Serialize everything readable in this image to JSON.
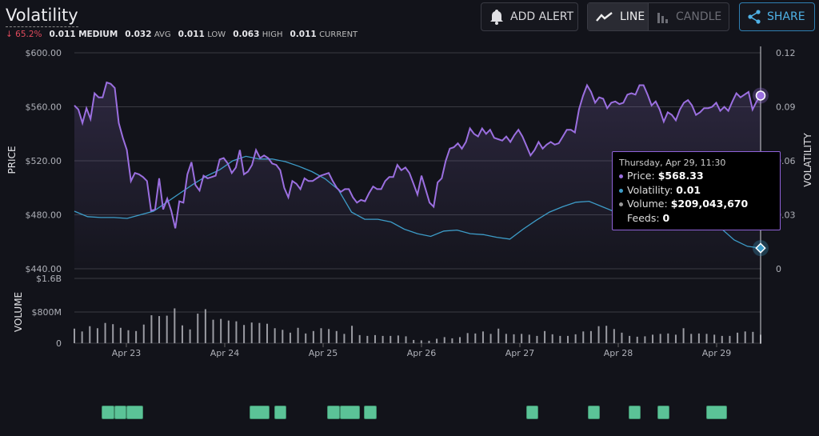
{
  "header": {
    "title": "Volatility",
    "change": "65.2%",
    "change_icon": "arrow-down-icon",
    "stats": [
      {
        "value": "0.011",
        "label": "MEDIUM"
      },
      {
        "value": "0.032",
        "label": "AVG"
      },
      {
        "value": "0.011",
        "label": "LOW"
      },
      {
        "value": "0.063",
        "label": "HIGH"
      },
      {
        "value": "0.011",
        "label": "CURRENT"
      }
    ]
  },
  "toolbar": {
    "add_alert": "ADD ALERT",
    "line": "LINE",
    "candle": "CANDLE",
    "share": "SHARE",
    "active_view": "line"
  },
  "tooltip": {
    "date": "Thursday, Apr 29, 11:30",
    "price_label": "Price:",
    "price": "$568.33",
    "volatility_label": "Volatility:",
    "volatility": "0.01",
    "volume_label": "Volume:",
    "volume": "$209,043,670",
    "feeds_label": "Feeds:",
    "feeds": "0"
  },
  "colors": {
    "price": "#9b6fe0",
    "volatility": "#3d9cc8",
    "volume": "#9a9ba2",
    "feeds": "#5bc397",
    "down": "#e04a5c",
    "share": "#4fb2e6"
  },
  "chart_data": {
    "type": "line",
    "x_ticks": [
      "Apr 23",
      "Apr 24",
      "Apr 25",
      "Apr 26",
      "Apr 27",
      "Apr 28",
      "Apr 29"
    ],
    "last_point": "Apr 29, 11:30",
    "price_axis": {
      "label": "PRICE",
      "ticks": [
        "$600.00",
        "$560.00",
        "$520.00",
        "$480.00",
        "$440.00"
      ],
      "ylim": [
        440,
        600
      ]
    },
    "volatility_axis": {
      "label": "VOLATILITY",
      "ticks": [
        "0.12",
        "0.09",
        "0.06",
        "0.03",
        "0"
      ],
      "ylim": [
        0,
        0.12
      ]
    },
    "volume_axis": {
      "label": "VOLUME",
      "ticks": [
        "$1.6B",
        "$800M",
        "0"
      ],
      "ylim_millions": [
        0,
        1600
      ]
    },
    "series": [
      {
        "name": "Price",
        "values": [
          561,
          558,
          548,
          559,
          551,
          570,
          567,
          567,
          578,
          577,
          574,
          548,
          537,
          528,
          505,
          511,
          510,
          508,
          505,
          483,
          484,
          507,
          484,
          492,
          483,
          470,
          490,
          489,
          510,
          519,
          502,
          498,
          509,
          507,
          508,
          509,
          521,
          522,
          518,
          511,
          515,
          528,
          510,
          512,
          517,
          528,
          522,
          524,
          522,
          518,
          517,
          513,
          500,
          493,
          505,
          503,
          499,
          507,
          505,
          505,
          507,
          509,
          510,
          511,
          505,
          500,
          497,
          499,
          499,
          493,
          489,
          491,
          490,
          496,
          501,
          499,
          499,
          505,
          508,
          508,
          517,
          513,
          515,
          511,
          503,
          495,
          509,
          499,
          489,
          486,
          504,
          507,
          520,
          529,
          530,
          533,
          529,
          534,
          544,
          540,
          538,
          544,
          540,
          543,
          537,
          536,
          535,
          538,
          534,
          539,
          543,
          538,
          531,
          524,
          528,
          534,
          529,
          532,
          534,
          532,
          533,
          538,
          543,
          543,
          541,
          558,
          568,
          576,
          571,
          563,
          567,
          566,
          559,
          563,
          564,
          562,
          563,
          569,
          570,
          569,
          576,
          576,
          569,
          561,
          564,
          558,
          549,
          556,
          554,
          550,
          558,
          563,
          565,
          561,
          554,
          556,
          559,
          559,
          560,
          563,
          557,
          560,
          557,
          564,
          570,
          567,
          569,
          571,
          558,
          564,
          568.33
        ]
      },
      {
        "name": "Volatility",
        "values": [
          0.032,
          0.029,
          0.0285,
          0.0285,
          0.028,
          0.03,
          0.032,
          0.037,
          0.042,
          0.047,
          0.0515,
          0.055,
          0.06,
          0.0625,
          0.061,
          0.061,
          0.0595,
          0.057,
          0.054,
          0.05,
          0.044,
          0.0315,
          0.0275,
          0.0275,
          0.026,
          0.022,
          0.0195,
          0.018,
          0.021,
          0.0215,
          0.0195,
          0.019,
          0.0175,
          0.0165,
          0.022,
          0.027,
          0.0315,
          0.0345,
          0.037,
          0.0375,
          0.0345,
          0.0315,
          0.029,
          0.029,
          0.032,
          0.0275,
          0.026,
          0.026,
          0.025,
          0.0225,
          0.016,
          0.0125,
          0.0115
        ]
      },
      {
        "name": "Volume",
        "unit": "millions",
        "values": [
          360,
          290,
          420,
          370,
          500,
          470,
          380,
          320,
          300,
          460,
          690,
          670,
          680,
          860,
          440,
          340,
          730,
          840,
          580,
          600,
          560,
          540,
          450,
          510,
          500,
          480,
          370,
          330,
          260,
          380,
          240,
          300,
          370,
          350,
          300,
          230,
          430,
          200,
          180,
          200,
          180,
          180,
          190,
          170,
          80,
          70,
          60,
          110,
          150,
          120,
          150,
          250,
          240,
          290,
          230,
          360,
          230,
          220,
          230,
          210,
          180,
          300,
          220,
          180,
          180,
          220,
          290,
          300,
          420,
          430,
          350,
          260,
          180,
          160,
          170,
          210,
          230,
          240,
          210,
          370,
          230,
          240,
          230,
          210,
          180,
          180,
          260,
          290,
          280,
          209
        ]
      }
    ],
    "feeds": [
      {
        "time": "Apr 22 18:00",
        "hours": 3
      },
      {
        "time": "Apr 22 21:00",
        "hours": 3
      },
      {
        "time": "Apr 23 00:00",
        "hours": 4
      },
      {
        "time": "Apr 24 06:00",
        "hours": 5
      },
      {
        "time": "Apr 24 12:00",
        "hours": 3
      },
      {
        "time": "Apr 25 01:00",
        "hours": 3
      },
      {
        "time": "Apr 25 04:00",
        "hours": 5
      },
      {
        "time": "Apr 25 10:00",
        "hours": 3
      },
      {
        "time": "Apr 27 01:30",
        "hours": 3
      },
      {
        "time": "Apr 27 16:30",
        "hours": 3
      },
      {
        "time": "Apr 28 02:30",
        "hours": 3
      },
      {
        "time": "Apr 28 09:30",
        "hours": 3
      },
      {
        "time": "Apr 28 21:30",
        "hours": 5
      }
    ]
  }
}
